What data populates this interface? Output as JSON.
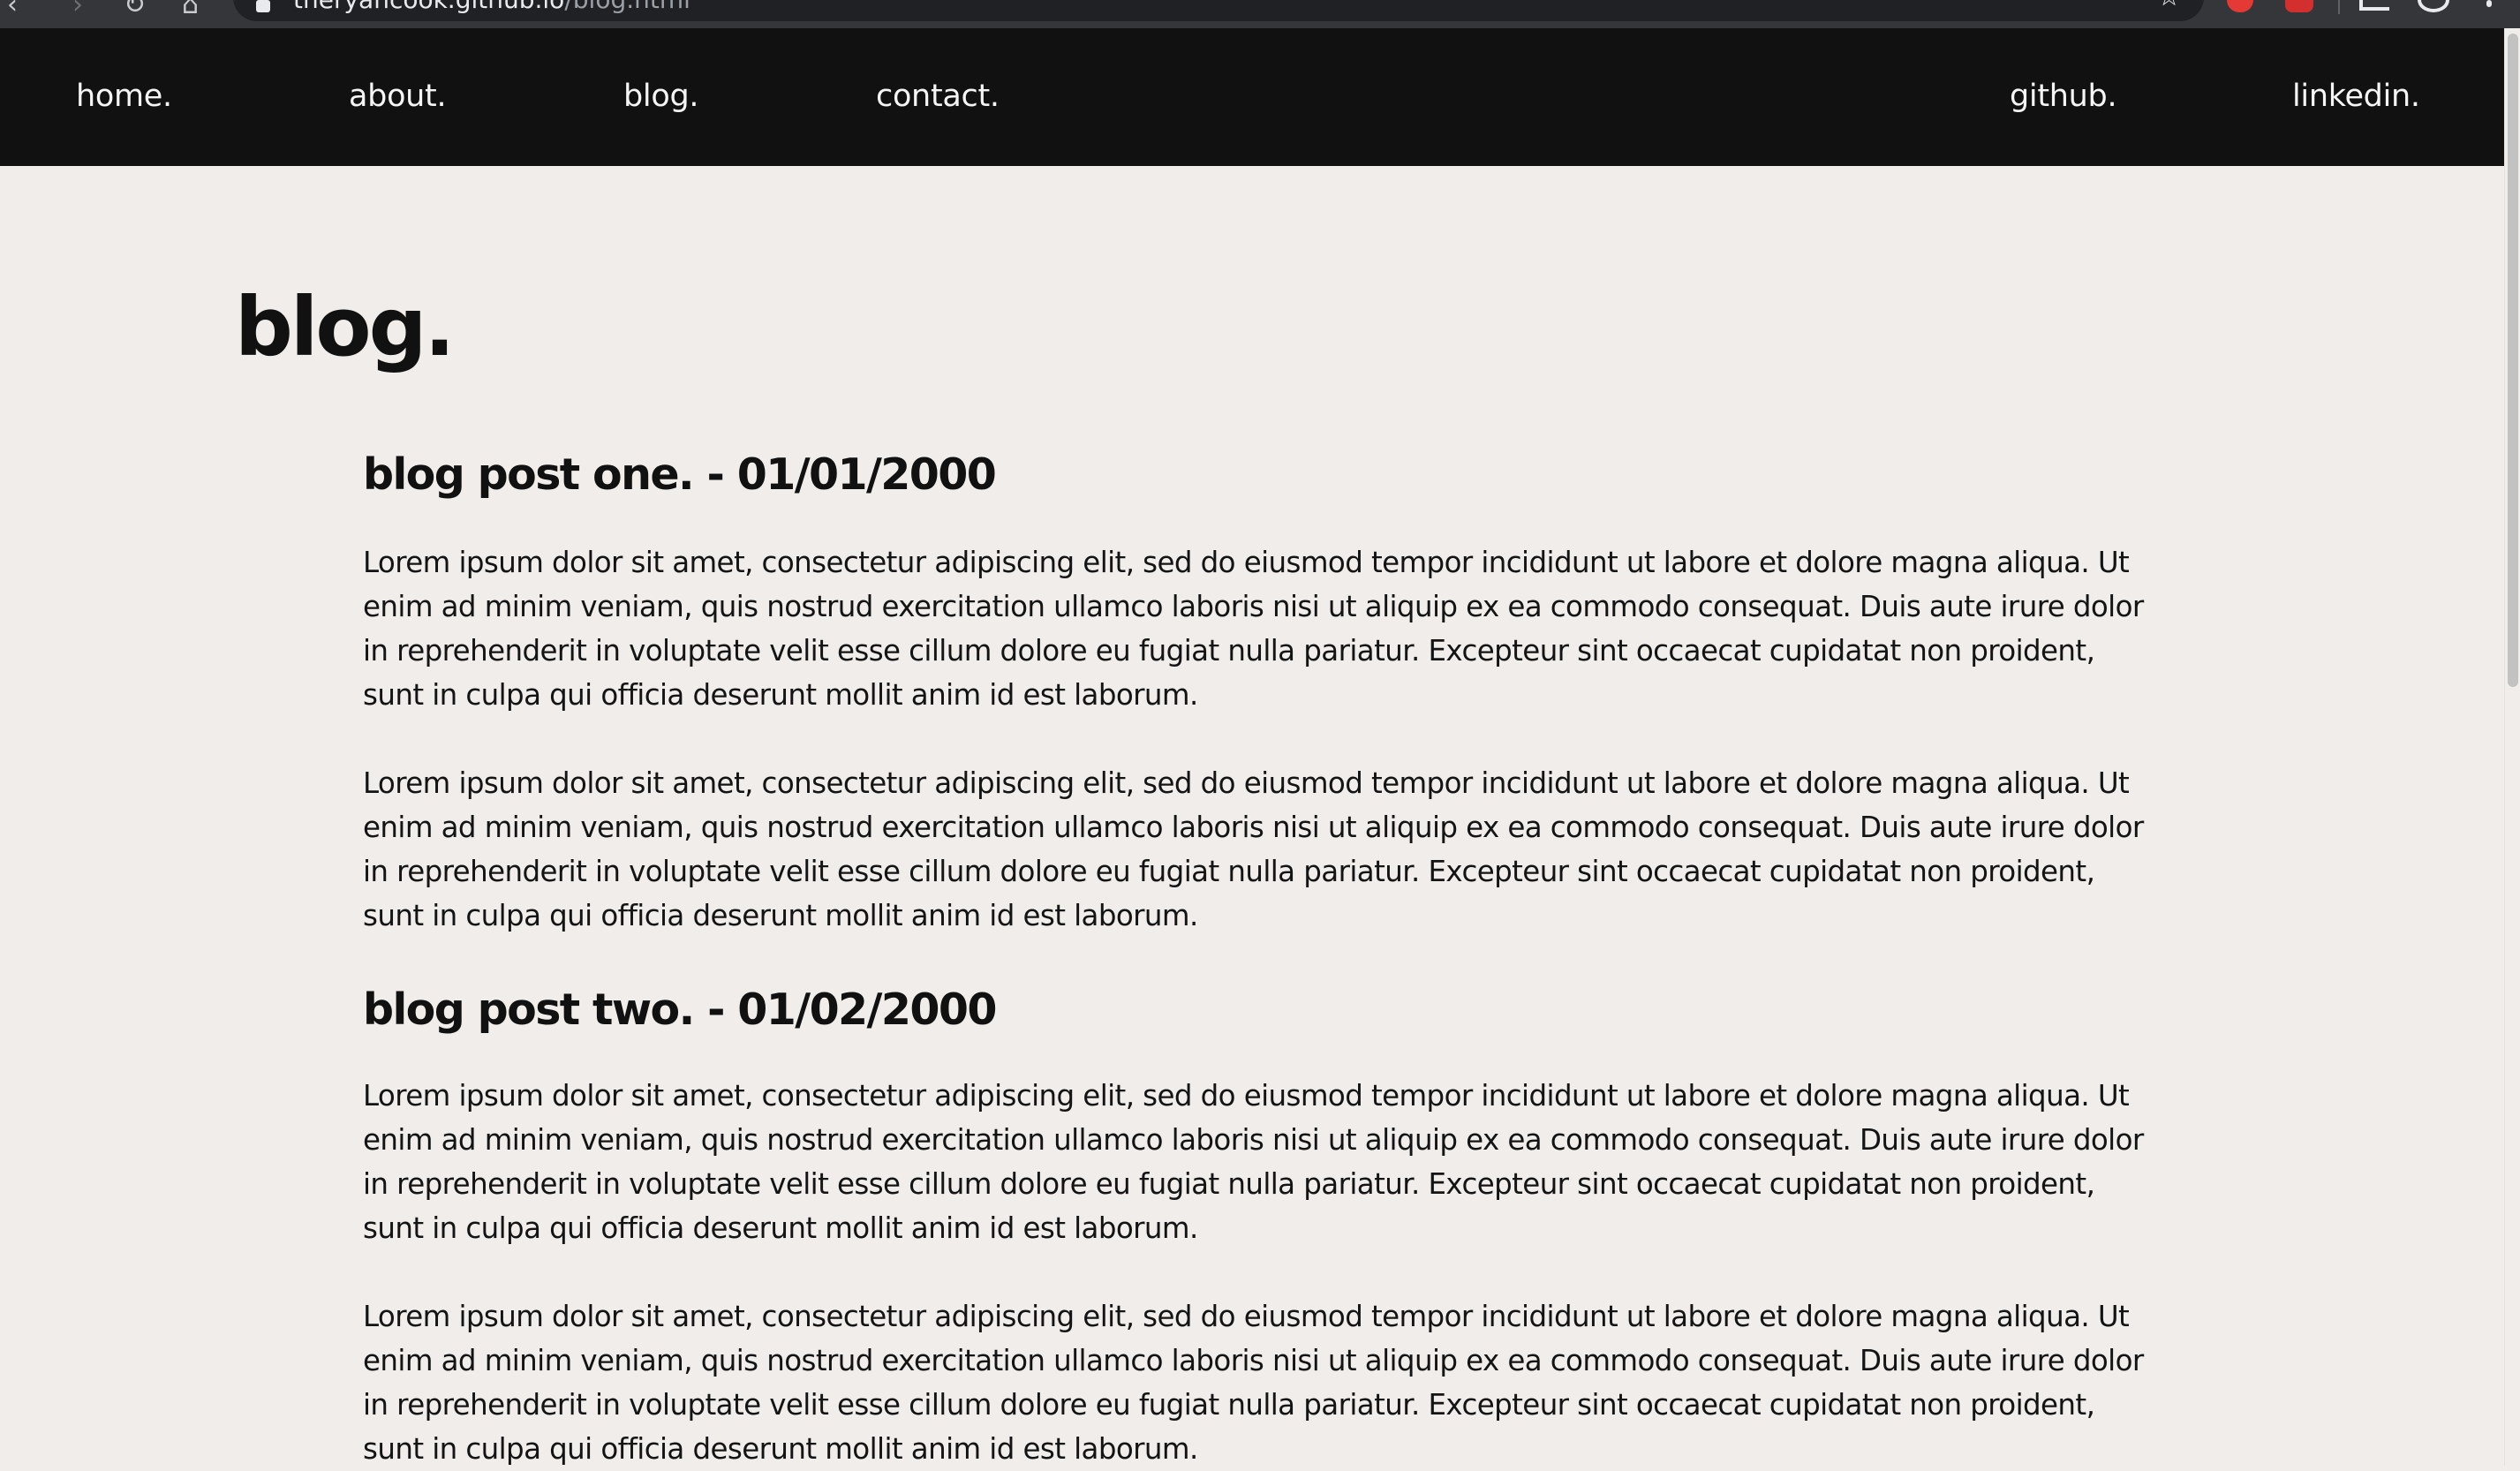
{
  "browser": {
    "url_host": "theryancook.github.io",
    "url_path": "/blog.html"
  },
  "nav": {
    "home": "home.",
    "about": "about.",
    "blog": "blog.",
    "contact": "contact.",
    "github": "github.",
    "linkedin": "linkedin."
  },
  "page": {
    "title": "blog."
  },
  "posts": [
    {
      "heading": "blog post one. - 01/01/2000",
      "paragraphs": [
        "Lorem ipsum dolor sit amet, consectetur adipiscing elit, sed do eiusmod tempor incididunt ut labore et dolore magna aliqua. Ut enim ad minim veniam, quis nostrud exercitation ullamco laboris nisi ut aliquip ex ea commodo consequat. Duis aute irure dolor in reprehenderit in voluptate velit esse cillum dolore eu fugiat nulla pariatur. Excepteur sint occaecat cupidatat non proident, sunt in culpa qui officia deserunt mollit anim id est laborum.",
        "Lorem ipsum dolor sit amet, consectetur adipiscing elit, sed do eiusmod tempor incididunt ut labore et dolore magna aliqua. Ut enim ad minim veniam, quis nostrud exercitation ullamco laboris nisi ut aliquip ex ea commodo consequat. Duis aute irure dolor in reprehenderit in voluptate velit esse cillum dolore eu fugiat nulla pariatur. Excepteur sint occaecat cupidatat non proident, sunt in culpa qui officia deserunt mollit anim id est laborum."
      ]
    },
    {
      "heading": "blog post two. - 01/02/2000",
      "paragraphs": [
        "Lorem ipsum dolor sit amet, consectetur adipiscing elit, sed do eiusmod tempor incididunt ut labore et dolore magna aliqua. Ut enim ad minim veniam, quis nostrud exercitation ullamco laboris nisi ut aliquip ex ea commodo consequat. Duis aute irure dolor in reprehenderit in voluptate velit esse cillum dolore eu fugiat nulla pariatur. Excepteur sint occaecat cupidatat non proident, sunt in culpa qui officia deserunt mollit anim id est laborum.",
        "Lorem ipsum dolor sit amet, consectetur adipiscing elit, sed do eiusmod tempor incididunt ut labore et dolore magna aliqua. Ut enim ad minim veniam, quis nostrud exercitation ullamco laboris nisi ut aliquip ex ea commodo consequat. Duis aute irure dolor in reprehenderit in voluptate velit esse cillum dolore eu fugiat nulla pariatur. Excepteur sint occaecat cupidatat non proident, sunt in culpa qui officia deserunt mollit anim id est laborum."
      ]
    }
  ],
  "colors": {
    "navbar_bg": "#111111",
    "page_bg": "#f0edea",
    "text": "#111111",
    "nav_text": "#f5f5f5"
  },
  "icons": [
    "back-icon",
    "forward-icon",
    "reload-icon",
    "home-icon",
    "lock-icon",
    "bookmark-star-icon",
    "extension-icon",
    "media-icon",
    "profile-icon",
    "menu-icon"
  ]
}
